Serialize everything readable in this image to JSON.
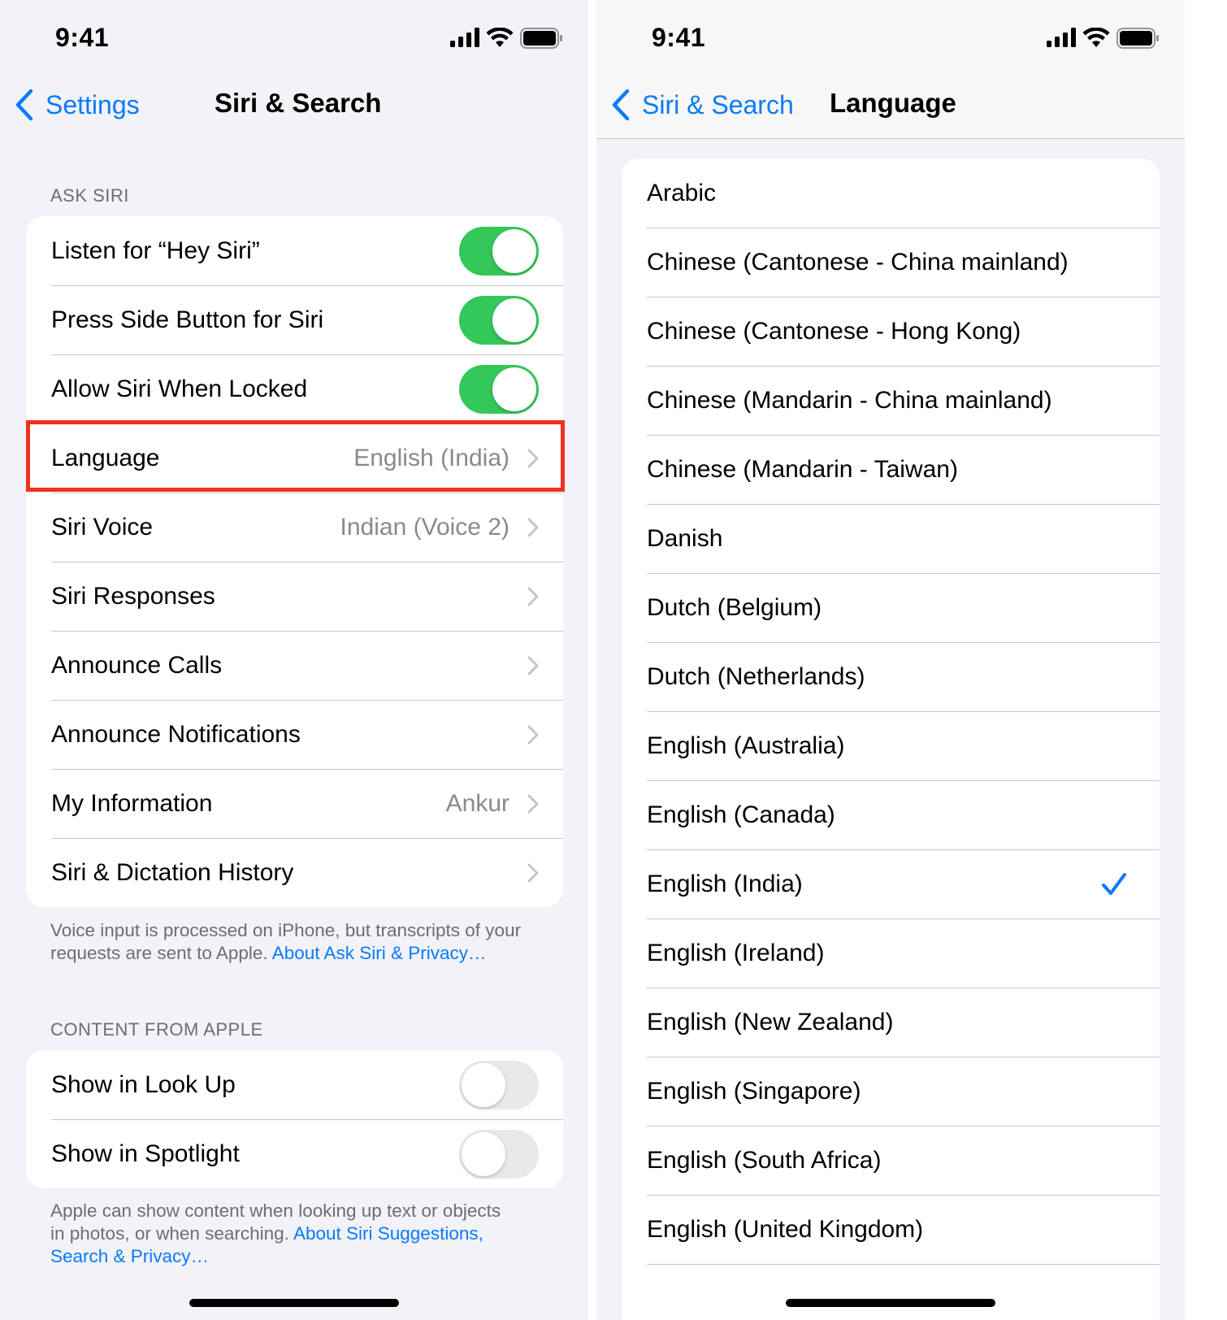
{
  "left": {
    "status": {
      "time": "9:41"
    },
    "nav": {
      "back_label": "Settings",
      "title": "Siri & Search"
    },
    "ask_siri": {
      "header": "ASK SIRI",
      "rows": [
        {
          "label": "Listen for “Hey Siri”",
          "toggle": true
        },
        {
          "label": "Press Side Button for Siri",
          "toggle": true
        },
        {
          "label": "Allow Siri When Locked",
          "toggle": true
        },
        {
          "label": "Language",
          "value": "English (India)"
        },
        {
          "label": "Siri Voice",
          "value": "Indian (Voice 2)"
        },
        {
          "label": "Siri Responses",
          "value": ""
        },
        {
          "label": "Announce Calls",
          "value": ""
        },
        {
          "label": "Announce Notifications",
          "value": ""
        },
        {
          "label": "My Information",
          "value": "Ankur"
        },
        {
          "label": "Siri & Dictation History",
          "value": ""
        }
      ],
      "footer_text": "Voice input is processed on iPhone, but transcripts of your requests are sent to Apple. ",
      "footer_link": "About Ask Siri & Privacy…"
    },
    "content_from_apple": {
      "header": "CONTENT FROM APPLE",
      "rows": [
        {
          "label": "Show in Look Up",
          "toggle": false
        },
        {
          "label": "Show in Spotlight",
          "toggle": false
        }
      ],
      "footer_text": "Apple can show content when looking up text or objects in photos, or when searching. ",
      "footer_link": "About Siri Suggestions, Search & Privacy…"
    }
  },
  "right": {
    "status": {
      "time": "9:41"
    },
    "nav": {
      "back_label": "Siri & Search",
      "title": "Language"
    },
    "languages": [
      "Arabic",
      "Chinese (Cantonese - China mainland)",
      "Chinese (Cantonese - Hong Kong)",
      "Chinese (Mandarin - China mainland)",
      "Chinese (Mandarin - Taiwan)",
      "Danish",
      "Dutch (Belgium)",
      "Dutch (Netherlands)",
      "English (Australia)",
      "English (Canada)",
      "English (India)",
      "English (Ireland)",
      "English (New Zealand)",
      "English (Singapore)",
      "English (South Africa)",
      "English (United Kingdom)"
    ],
    "selected_language": "English (India)"
  },
  "colors": {
    "accent": "#0a7aff",
    "toggle_on": "#34c759",
    "highlight": "#f0311f"
  }
}
